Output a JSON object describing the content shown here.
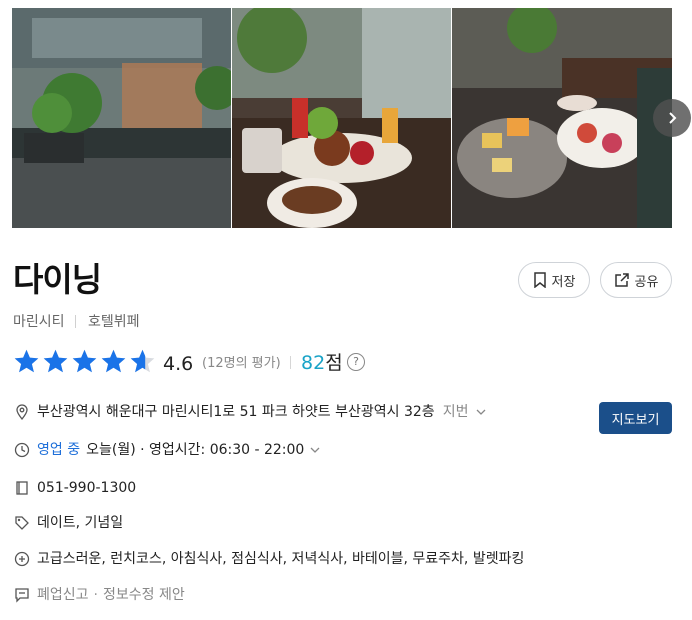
{
  "place": {
    "name": "다이닝",
    "category_area": "마린시티",
    "category_type": "호텔뷔페",
    "rating": "4.6",
    "review_count": "(12명의 평가)",
    "score_value": "82",
    "score_unit": "점",
    "help_glyph": "?"
  },
  "actions": {
    "save_label": "저장",
    "share_label": "공유"
  },
  "info": {
    "address": "부산광역시 해운대구 마린시티1로 51 파크 하얏트 부산광역시 32층",
    "address_toggle": "지번",
    "map_button": "지도보기",
    "open_status": "영업 중",
    "hours": "오늘(월) · 영업시간: 06:30 - 22:00",
    "phone": "051-990-1300",
    "tags": "데이트, 기념일",
    "features": "고급스러운, 런치코스, 아침식사, 점심식사, 저녁식사, 바테이블, 무료주차, 발렛파킹",
    "report_closed": "폐업신고",
    "suggest_edit": "정보수정 제안"
  },
  "stars": {
    "filled": 4.6,
    "total": 5,
    "color": "#1a73e8"
  },
  "colors": {
    "brand_blue": "#1b4f8a",
    "score": "#19a3c7",
    "open": "#1e6fd9"
  },
  "icons": [
    "next-arrow-icon",
    "bookmark-icon",
    "share-icon",
    "location-pin-icon",
    "clock-icon",
    "phone-icon",
    "tag-icon",
    "plus-circle-icon",
    "report-icon",
    "chevron-down-icon",
    "help-icon",
    "star-icon"
  ]
}
